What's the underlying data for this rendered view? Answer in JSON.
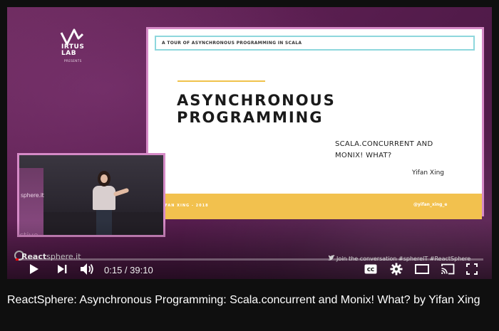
{
  "slide": {
    "header": "A TOUR OF ASYNCHRONOUS PROGRAMMING IN SCALA",
    "title_line1": "ASYNCHRONOUS",
    "title_line2": "PROGRAMMING",
    "subtitle_line1": "SCALA.CONCURRENT AND",
    "subtitle_line2": "MONIX! WHAT?",
    "author": "Yifan Xing",
    "footer_left": "YIFAN XING - 2018",
    "footer_right": "@yifan_xing_e"
  },
  "logo": {
    "name_line1": "IRTUS",
    "name_line2": "LAB",
    "sub": "PRESENTS"
  },
  "camera": {
    "banner_text": "sphere.it",
    "banner_text2": "ctive"
  },
  "overlay": {
    "brand": "React",
    "brand_sub": "sphere.it",
    "twitter_text": "Join the conversation #sphereIT #ReactSphere"
  },
  "controls": {
    "current_time": "0:15",
    "separator": " / ",
    "duration": "39:10",
    "progress_fraction": 0.0064
  },
  "video": {
    "title": "ReactSphere: Asynchronous Programming: Scala.concurrent and Monix! What? by Yifan Xing"
  },
  "colors": {
    "accent_red": "#ff0000",
    "slide_border": "#d68ac7",
    "slide_footer": "#f2c14e",
    "header_border": "#8ed7dd",
    "background": "#0f0f0f"
  }
}
